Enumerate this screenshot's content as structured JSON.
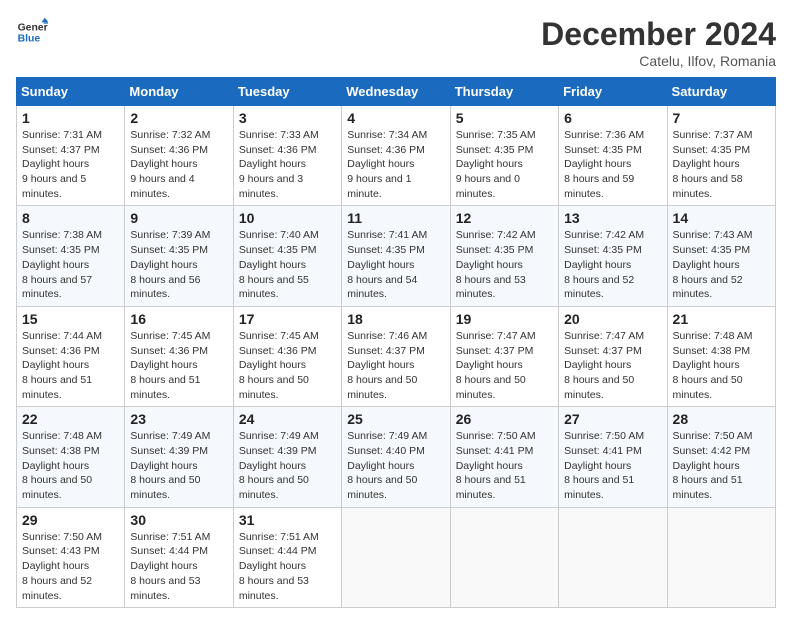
{
  "header": {
    "logo_general": "General",
    "logo_blue": "Blue",
    "month_title": "December 2024",
    "location": "Catelu, Ilfov, Romania"
  },
  "weekdays": [
    "Sunday",
    "Monday",
    "Tuesday",
    "Wednesday",
    "Thursday",
    "Friday",
    "Saturday"
  ],
  "weeks": [
    [
      {
        "day": "1",
        "sunrise": "7:31 AM",
        "sunset": "4:37 PM",
        "daylight": "9 hours and 5 minutes."
      },
      {
        "day": "2",
        "sunrise": "7:32 AM",
        "sunset": "4:36 PM",
        "daylight": "9 hours and 4 minutes."
      },
      {
        "day": "3",
        "sunrise": "7:33 AM",
        "sunset": "4:36 PM",
        "daylight": "9 hours and 3 minutes."
      },
      {
        "day": "4",
        "sunrise": "7:34 AM",
        "sunset": "4:36 PM",
        "daylight": "9 hours and 1 minute."
      },
      {
        "day": "5",
        "sunrise": "7:35 AM",
        "sunset": "4:35 PM",
        "daylight": "9 hours and 0 minutes."
      },
      {
        "day": "6",
        "sunrise": "7:36 AM",
        "sunset": "4:35 PM",
        "daylight": "8 hours and 59 minutes."
      },
      {
        "day": "7",
        "sunrise": "7:37 AM",
        "sunset": "4:35 PM",
        "daylight": "8 hours and 58 minutes."
      }
    ],
    [
      {
        "day": "8",
        "sunrise": "7:38 AM",
        "sunset": "4:35 PM",
        "daylight": "8 hours and 57 minutes."
      },
      {
        "day": "9",
        "sunrise": "7:39 AM",
        "sunset": "4:35 PM",
        "daylight": "8 hours and 56 minutes."
      },
      {
        "day": "10",
        "sunrise": "7:40 AM",
        "sunset": "4:35 PM",
        "daylight": "8 hours and 55 minutes."
      },
      {
        "day": "11",
        "sunrise": "7:41 AM",
        "sunset": "4:35 PM",
        "daylight": "8 hours and 54 minutes."
      },
      {
        "day": "12",
        "sunrise": "7:42 AM",
        "sunset": "4:35 PM",
        "daylight": "8 hours and 53 minutes."
      },
      {
        "day": "13",
        "sunrise": "7:42 AM",
        "sunset": "4:35 PM",
        "daylight": "8 hours and 52 minutes."
      },
      {
        "day": "14",
        "sunrise": "7:43 AM",
        "sunset": "4:35 PM",
        "daylight": "8 hours and 52 minutes."
      }
    ],
    [
      {
        "day": "15",
        "sunrise": "7:44 AM",
        "sunset": "4:36 PM",
        "daylight": "8 hours and 51 minutes."
      },
      {
        "day": "16",
        "sunrise": "7:45 AM",
        "sunset": "4:36 PM",
        "daylight": "8 hours and 51 minutes."
      },
      {
        "day": "17",
        "sunrise": "7:45 AM",
        "sunset": "4:36 PM",
        "daylight": "8 hours and 50 minutes."
      },
      {
        "day": "18",
        "sunrise": "7:46 AM",
        "sunset": "4:37 PM",
        "daylight": "8 hours and 50 minutes."
      },
      {
        "day": "19",
        "sunrise": "7:47 AM",
        "sunset": "4:37 PM",
        "daylight": "8 hours and 50 minutes."
      },
      {
        "day": "20",
        "sunrise": "7:47 AM",
        "sunset": "4:37 PM",
        "daylight": "8 hours and 50 minutes."
      },
      {
        "day": "21",
        "sunrise": "7:48 AM",
        "sunset": "4:38 PM",
        "daylight": "8 hours and 50 minutes."
      }
    ],
    [
      {
        "day": "22",
        "sunrise": "7:48 AM",
        "sunset": "4:38 PM",
        "daylight": "8 hours and 50 minutes."
      },
      {
        "day": "23",
        "sunrise": "7:49 AM",
        "sunset": "4:39 PM",
        "daylight": "8 hours and 50 minutes."
      },
      {
        "day": "24",
        "sunrise": "7:49 AM",
        "sunset": "4:39 PM",
        "daylight": "8 hours and 50 minutes."
      },
      {
        "day": "25",
        "sunrise": "7:49 AM",
        "sunset": "4:40 PM",
        "daylight": "8 hours and 50 minutes."
      },
      {
        "day": "26",
        "sunrise": "7:50 AM",
        "sunset": "4:41 PM",
        "daylight": "8 hours and 51 minutes."
      },
      {
        "day": "27",
        "sunrise": "7:50 AM",
        "sunset": "4:41 PM",
        "daylight": "8 hours and 51 minutes."
      },
      {
        "day": "28",
        "sunrise": "7:50 AM",
        "sunset": "4:42 PM",
        "daylight": "8 hours and 51 minutes."
      }
    ],
    [
      {
        "day": "29",
        "sunrise": "7:50 AM",
        "sunset": "4:43 PM",
        "daylight": "8 hours and 52 minutes."
      },
      {
        "day": "30",
        "sunrise": "7:51 AM",
        "sunset": "4:44 PM",
        "daylight": "8 hours and 53 minutes."
      },
      {
        "day": "31",
        "sunrise": "7:51 AM",
        "sunset": "4:44 PM",
        "daylight": "8 hours and 53 minutes."
      },
      null,
      null,
      null,
      null
    ]
  ],
  "labels": {
    "sunrise": "Sunrise:",
    "sunset": "Sunset:",
    "daylight": "Daylight hours"
  }
}
